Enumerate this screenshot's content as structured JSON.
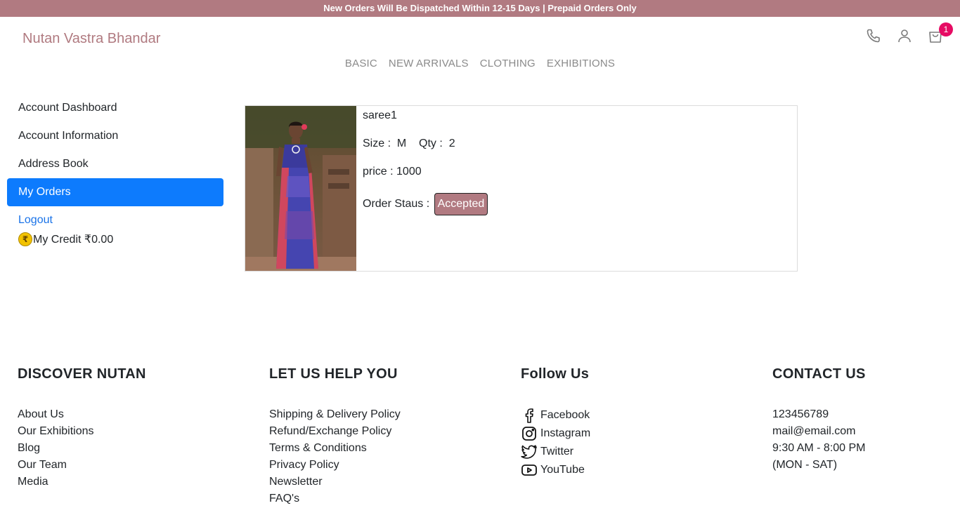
{
  "announcement": "New Orders Will Be Dispatched Within 12-15 Days | Prepaid Orders Only",
  "brand": "Nutan Vastra Bhandar",
  "header": {
    "icons": [
      "phone-icon",
      "user-icon",
      "cart-icon"
    ],
    "cart_count": "1"
  },
  "nav": [
    "BASIC",
    "NEW ARRIVALS",
    "CLOTHING",
    "EXHIBITIONS"
  ],
  "sidebar": {
    "items": [
      {
        "label": "Account Dashboard"
      },
      {
        "label": "Account Information"
      },
      {
        "label": "Address Book"
      },
      {
        "label": "My Orders"
      },
      {
        "label": "Logout"
      }
    ],
    "credit_symbol": "₹",
    "credit": "My Credit ₹0.00"
  },
  "order": {
    "name": "saree1",
    "size_label": "Size :",
    "size": "M",
    "qty_label": "Qty :",
    "qty": "2",
    "price": "price : 1000",
    "status_label": "Order Staus :",
    "status": "Accepted"
  },
  "footer": {
    "discover": {
      "title": "DISCOVER NUTAN",
      "links": [
        "About Us",
        "Our Exhibitions",
        "Blog",
        "Our Team",
        "Media"
      ]
    },
    "help": {
      "title": "LET US HELP YOU",
      "links": [
        "Shipping & Delivery Policy",
        "Refund/Exchange Policy",
        "Terms & Conditions",
        "Privacy Policy",
        "Newsletter",
        "FAQ's"
      ]
    },
    "follow": {
      "title": "Follow Us",
      "links": [
        "Facebook",
        "Instagram",
        "Twitter",
        "YouTube"
      ]
    },
    "contact": {
      "title": "CONTACT US",
      "lines": [
        "123456789",
        "mail@email.com",
        "9:30 AM - 8:00 PM",
        "(MON - SAT)"
      ]
    }
  },
  "colors": {
    "accent": "#b17a81",
    "active": "#0d7bfd",
    "badge": "#e60b63"
  }
}
